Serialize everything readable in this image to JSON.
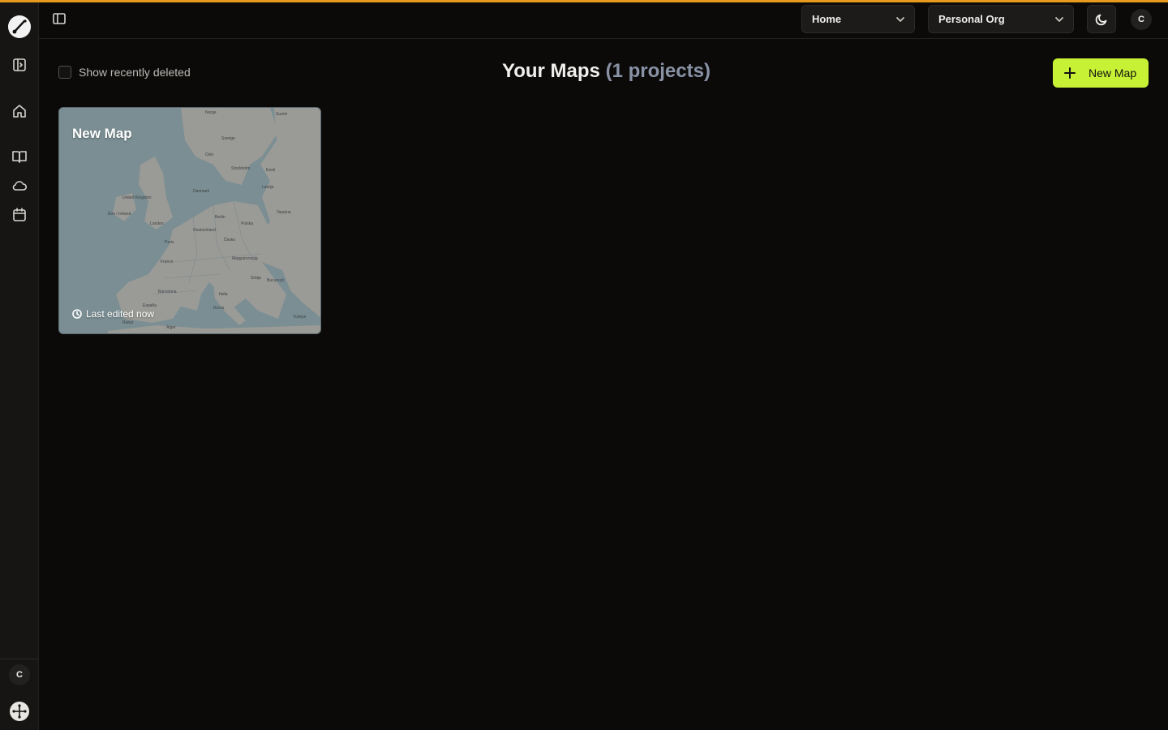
{
  "header": {
    "workspace_select": "Home",
    "org_select": "Personal Org",
    "user_initial": "C"
  },
  "sidebar": {
    "user_initial": "C",
    "items": [
      {
        "icon": "sidebar-toggle-icon"
      },
      {
        "icon": "home-icon"
      },
      {
        "icon": "book-icon"
      },
      {
        "icon": "cloud-icon"
      },
      {
        "icon": "calendar-icon"
      }
    ]
  },
  "toolbar": {
    "show_deleted_label": "Show recently deleted",
    "new_map_label": "New Map"
  },
  "page": {
    "title": "Your Maps",
    "count": "(1 projects)"
  },
  "maps": [
    {
      "title": "New Map",
      "meta": "Last edited now"
    }
  ],
  "map_labels": [
    "Norge",
    "Sverige",
    "Suomi",
    "Oslo",
    "Stockholm",
    "Eesti",
    "Latvija",
    "Danmark",
    "United Kingdom",
    "Éire / Ireland",
    "London",
    "Berlin",
    "Polska",
    "Deutschland",
    "Paris",
    "France",
    "Česko",
    "Magyarország",
    "Italia",
    "Barcelona",
    "España",
    "Roma",
    "Srbija",
    "București",
    "Україна",
    "Türkiye",
    "Alger",
    "Rabat"
  ],
  "colors": {
    "accent": "#c6f135",
    "topline": "#e89a1c",
    "background": "#0b0a09"
  }
}
